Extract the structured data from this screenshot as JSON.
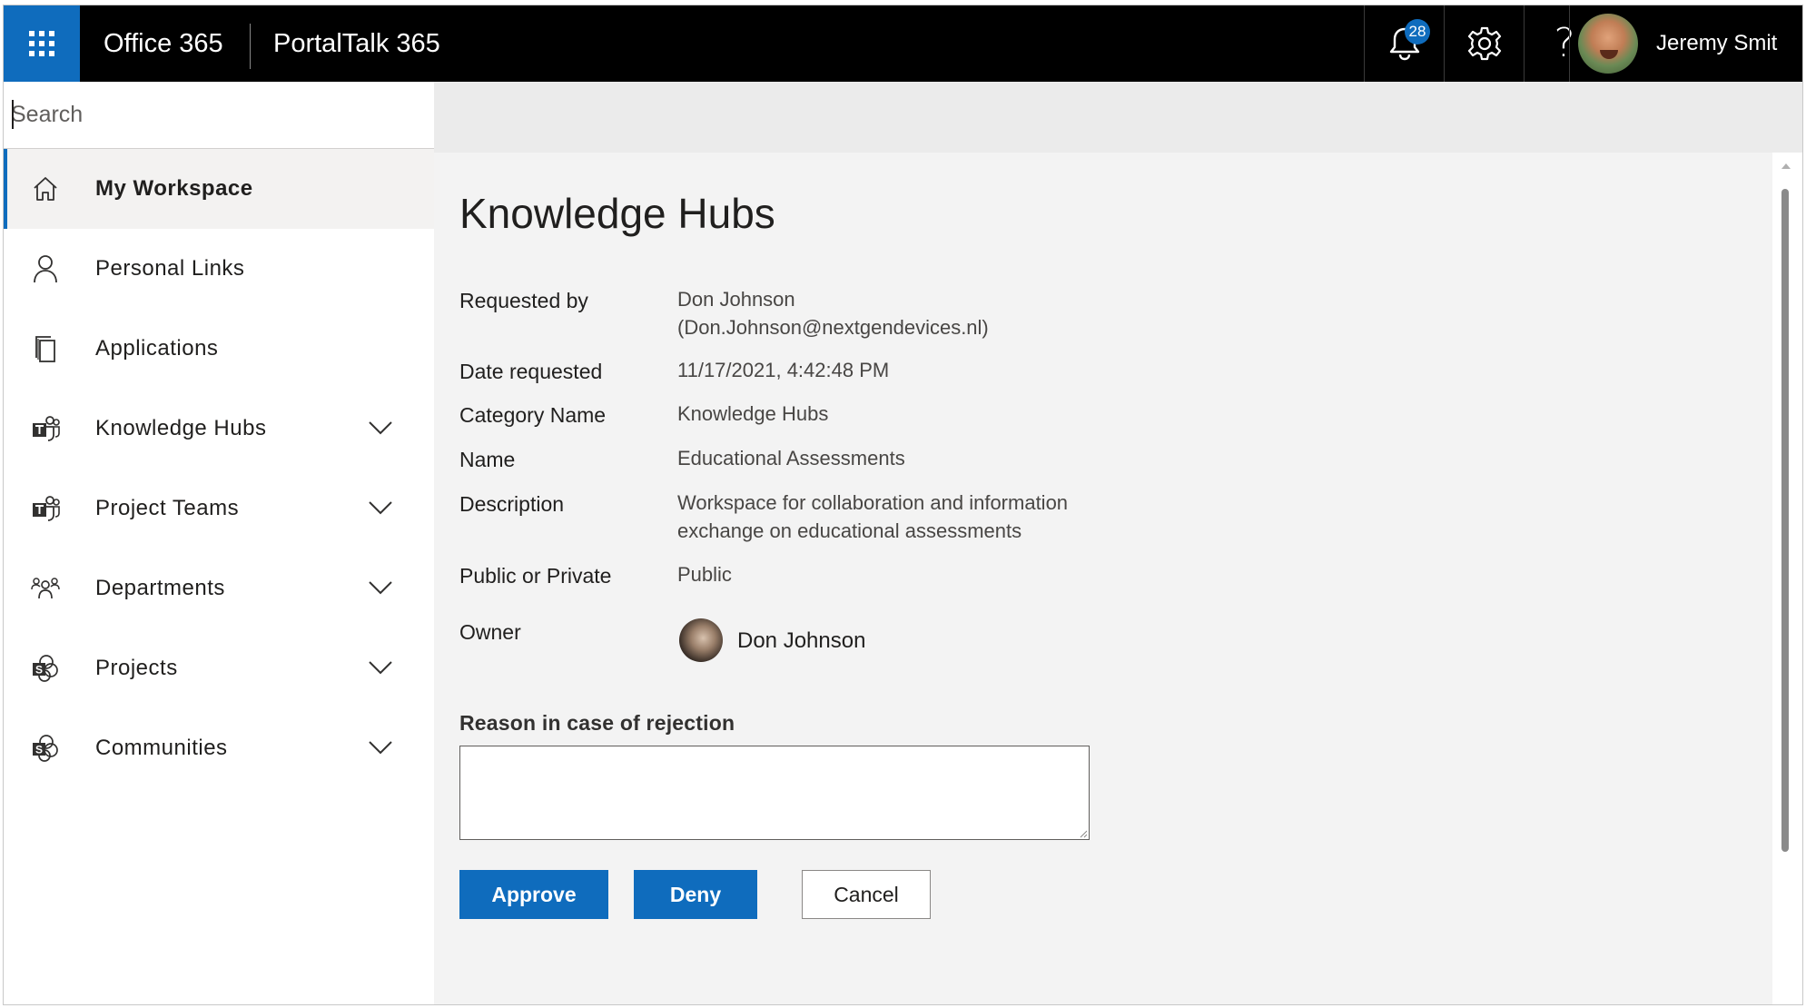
{
  "topbar": {
    "suite_title": "Office 365",
    "app_title": "PortalTalk 365",
    "notification_count": "28",
    "help_glyph": "?",
    "user_name": "Jeremy Smit"
  },
  "search": {
    "placeholder": "Search"
  },
  "sidebar": {
    "items": [
      {
        "label": "My Workspace",
        "icon": "home-icon",
        "expandable": false,
        "active": true
      },
      {
        "label": "Personal Links",
        "icon": "person-icon",
        "expandable": false,
        "active": false
      },
      {
        "label": "Applications",
        "icon": "pages-icon",
        "expandable": false,
        "active": false
      },
      {
        "label": "Knowledge Hubs",
        "icon": "teams-icon",
        "expandable": true,
        "active": false
      },
      {
        "label": "Project Teams",
        "icon": "teams-icon",
        "expandable": true,
        "active": false
      },
      {
        "label": "Departments",
        "icon": "people-group-icon",
        "expandable": true,
        "active": false
      },
      {
        "label": "Projects",
        "icon": "sharepoint-icon",
        "expandable": true,
        "active": false
      },
      {
        "label": "Communities",
        "icon": "sharepoint-icon",
        "expandable": true,
        "active": false
      }
    ]
  },
  "request": {
    "title": "Knowledge Hubs",
    "fields": {
      "requested_by": {
        "label": "Requested by",
        "value_name": "Don Johnson",
        "value_email": "(Don.Johnson@nextgendevices.nl)"
      },
      "date_requested": {
        "label": "Date requested",
        "value": "11/17/2021, 4:42:48 PM"
      },
      "category_name": {
        "label": "Category Name",
        "value": "Knowledge Hubs"
      },
      "name": {
        "label": "Name",
        "value": "Educational Assessments"
      },
      "description": {
        "label": "Description",
        "value_line1": "Workspace for collaboration and information",
        "value_line2": "exchange on educational assessments"
      },
      "visibility": {
        "label": "Public or Private",
        "value": "Public"
      },
      "owner": {
        "label": "Owner",
        "value": "Don Johnson"
      }
    },
    "reason_label": "Reason in case of rejection",
    "reason_value": "",
    "actions": {
      "approve": "Approve",
      "deny": "Deny",
      "cancel": "Cancel"
    }
  },
  "colors": {
    "accent": "#0f6cbd",
    "topbar": "#000000",
    "content_bg": "#f3f3f3"
  }
}
